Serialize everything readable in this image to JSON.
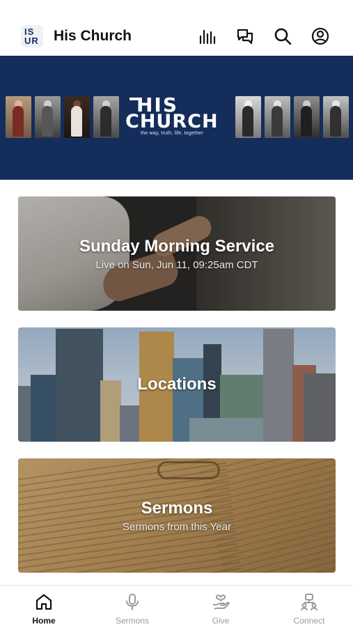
{
  "header": {
    "logo_line1": "IS",
    "logo_line2": "UR",
    "title": "His Church",
    "icons": [
      "stats-icon",
      "chat-icon",
      "search-icon",
      "profile-icon"
    ]
  },
  "banner": {
    "logo_top": "HIS",
    "logo_bottom": "CHURCH",
    "tagline": "the way, truth, life, together",
    "background_color": "#142d5a"
  },
  "cards": [
    {
      "title": "Sunday Morning Service",
      "subtitle": "Live on Sun, Jun 11, 09:25am CDT"
    },
    {
      "title": "Locations",
      "subtitle": ""
    },
    {
      "title": "Sermons",
      "subtitle": "Sermons from this Year"
    }
  ],
  "tabs": [
    {
      "label": "Home",
      "icon": "home-icon",
      "active": true
    },
    {
      "label": "Sermons",
      "icon": "microphone-icon",
      "active": false
    },
    {
      "label": "Give",
      "icon": "give-hand-heart-icon",
      "active": false
    },
    {
      "label": "Connect",
      "icon": "connect-people-icon",
      "active": false
    }
  ],
  "colors": {
    "brand_navy": "#142d5a",
    "tab_active": "#111111",
    "tab_inactive": "#9a9a9a"
  }
}
